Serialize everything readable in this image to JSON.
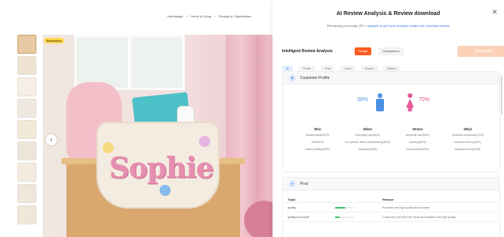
{
  "breadcrumb": [
    "Homepage",
    "Home & Living",
    "Storage & Organization"
  ],
  "product": {
    "badge": "Bestseller",
    "image_text": "Sophie",
    "nav_prev_icon": "chevron-left-icon"
  },
  "panel": {
    "title": "AI Review Analysis & Review download",
    "subtitle_prefix": "Remaining your today QPL:",
    "subtitle_link": "Upgrade to get more analysis credits and download access",
    "close_icon": "close-icon",
    "analysis_title": "Intelligent Review Analysis",
    "single_button": "Single",
    "compare_button": "Comparison",
    "download_button": "Download",
    "filter_tabs": [
      "All",
      "Profile",
      "Pros",
      "Cons",
      "Expect",
      "Motive"
    ],
    "profile": {
      "title": "Customer Profile",
      "male_pct": "30%",
      "female_pct": "70%",
      "columns": [
        {
          "head": "Who",
          "values": [
            "toddlers/kids(42%)",
            "self(40%)",
            "newborn/baby(18%)"
          ]
        },
        {
          "head": "When",
          "values": [
            "everyday use(48%)",
            "on specific dates (mentioned)(28%)",
            "occasion(24%)"
          ]
        },
        {
          "head": "Where",
          "values": [
            "personal use(46%)",
            "nursery(30%)",
            "nursery/kids(24%)"
          ]
        },
        {
          "head": "What",
          "values": [
            "personal occasions(72%)",
            "bedroom items(18%)",
            "compact items(10%)"
          ]
        }
      ]
    },
    "pros": {
      "title": "Pros",
      "col_topic": "Topic",
      "col_reason": "Reason",
      "rows": [
        {
          "topic": "quality",
          "fill": 0.55,
          "reason": "Products are high quality and durable"
        },
        {
          "topic": "quality of product",
          "fill": 0.25,
          "reason": "Customers perceive the items as beautiful and high quality"
        }
      ]
    }
  },
  "colors": {
    "accent": "#ff5a1f",
    "male": "#4a90e2",
    "female": "#e75b9a",
    "link": "#2c7be5"
  }
}
